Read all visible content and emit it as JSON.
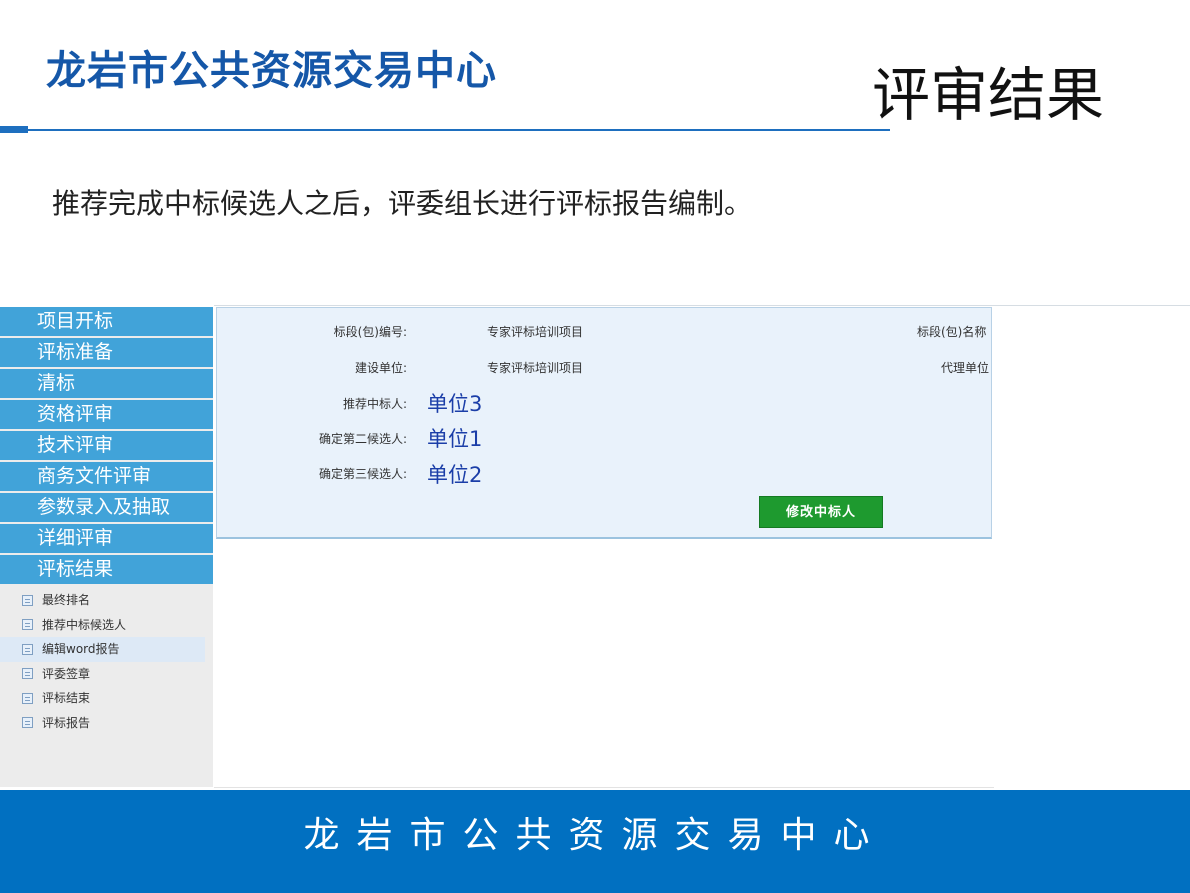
{
  "header": {
    "org_title": "龙岩市公共资源交易中心",
    "page_title": "评审结果"
  },
  "description": "推荐完成中标候选人之后，评委组长进行评标报告编制。",
  "sidebar": {
    "items": [
      {
        "label": "项目开标"
      },
      {
        "label": "评标准备"
      },
      {
        "label": "清标"
      },
      {
        "label": "资格评审"
      },
      {
        "label": "技术评审"
      },
      {
        "label": "商务文件评审"
      },
      {
        "label": "参数录入及抽取"
      },
      {
        "label": "详细评审"
      },
      {
        "label": "评标结果"
      }
    ],
    "sub_items": [
      {
        "label": "最终排名",
        "active": false
      },
      {
        "label": "推荐中标候选人",
        "active": false
      },
      {
        "label": "编辑word报告",
        "active": true
      },
      {
        "label": "评委签章",
        "active": false
      },
      {
        "label": "评标结束",
        "active": false
      },
      {
        "label": "评标报告",
        "active": false
      }
    ]
  },
  "panel": {
    "section_code_label": "标段(包)编号:",
    "section_code_value": "专家评标培训项目",
    "section_name_label": "标段(包)名称",
    "builder_label": "建设单位:",
    "builder_value": "专家评标培训项目",
    "agent_label": "代理单位",
    "recommended_label": "推荐中标人:",
    "recommended_value": "单位3",
    "second_label": "确定第二候选人:",
    "second_value": "单位1",
    "third_label": "确定第三候选人:",
    "third_value": "单位2",
    "modify_button": "修改中标人"
  },
  "footer": {
    "text": "龙岩市公共资源交易中心"
  },
  "colors": {
    "brand_blue": "#1557a8",
    "nav_blue": "#41a3d9",
    "footer_blue": "#0170c1",
    "button_green": "#1e9a2f",
    "value_blue": "#1b3ea8"
  }
}
